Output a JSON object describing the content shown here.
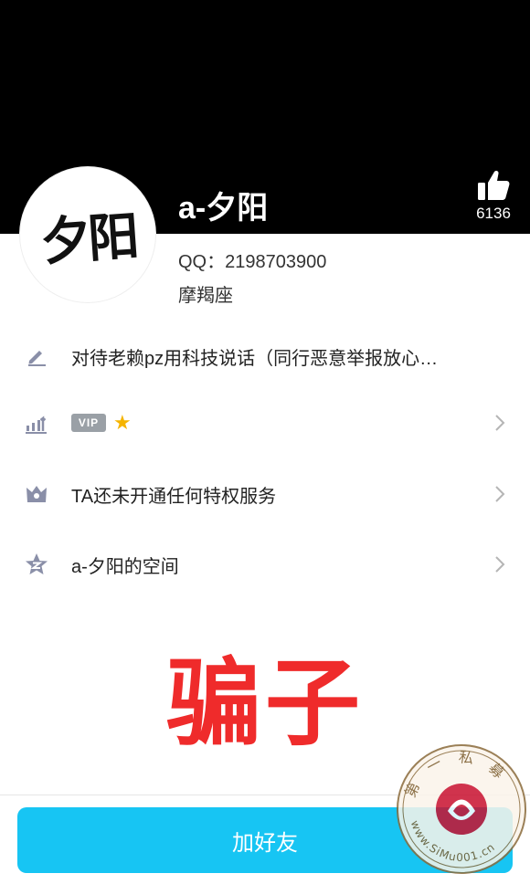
{
  "profile": {
    "nickname": "a-夕阳",
    "avatar_text": "夕阳",
    "likes": "6136",
    "qq_line": "QQ：2198703900",
    "sign": "摩羯座"
  },
  "rows": [
    {
      "icon": "pencil-icon",
      "label": "对待老赖pz用科技说话（同行恶意举报放心…"
    },
    {
      "icon": "level-icon",
      "vip_label": "VIP",
      "star": "★"
    },
    {
      "icon": "privilege-icon",
      "label": "TA还未开通任何特权服务"
    },
    {
      "icon": "qzone-star-icon",
      "label": "a-夕阳的空间"
    }
  ],
  "overlay_text": "骗子",
  "add_friend_label": "加好友",
  "watermark": {
    "top_text": "第 一 私 募",
    "bottom_text": "www.SiMu001.cn"
  },
  "colors": {
    "cover": "#000000",
    "button": "#17c5f3",
    "overlay": "#ef2b2b",
    "icon": "#8a8fa8"
  }
}
